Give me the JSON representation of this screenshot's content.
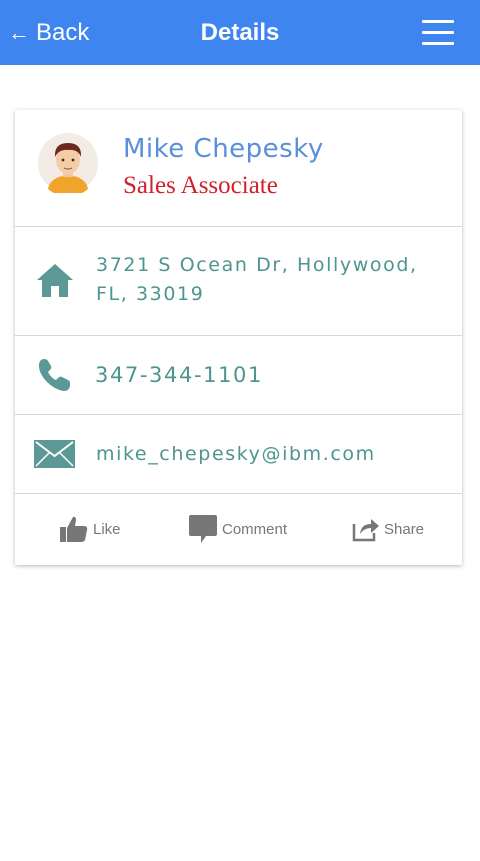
{
  "nav": {
    "back_arrow": "←",
    "back_label": "Back",
    "title": "Details",
    "menu_icon": "hamburger-menu-icon"
  },
  "contact": {
    "name": "Mike Chepesky",
    "role": "Sales Associate",
    "address": "3721 S Ocean Dr, Hollywood, FL, 33019",
    "phone": "347-344-1101",
    "email": "mike_chepesky@ibm.com"
  },
  "actions": {
    "like_label": "Like",
    "comment_label": "Comment",
    "share_label": "Share"
  },
  "colors": {
    "navbar": "#3f85f0",
    "name": "#5a8fdc",
    "role": "#d0202e",
    "teal_text": "#4e9490",
    "icon_teal": "#5b9896",
    "action_gray": "#777777"
  }
}
